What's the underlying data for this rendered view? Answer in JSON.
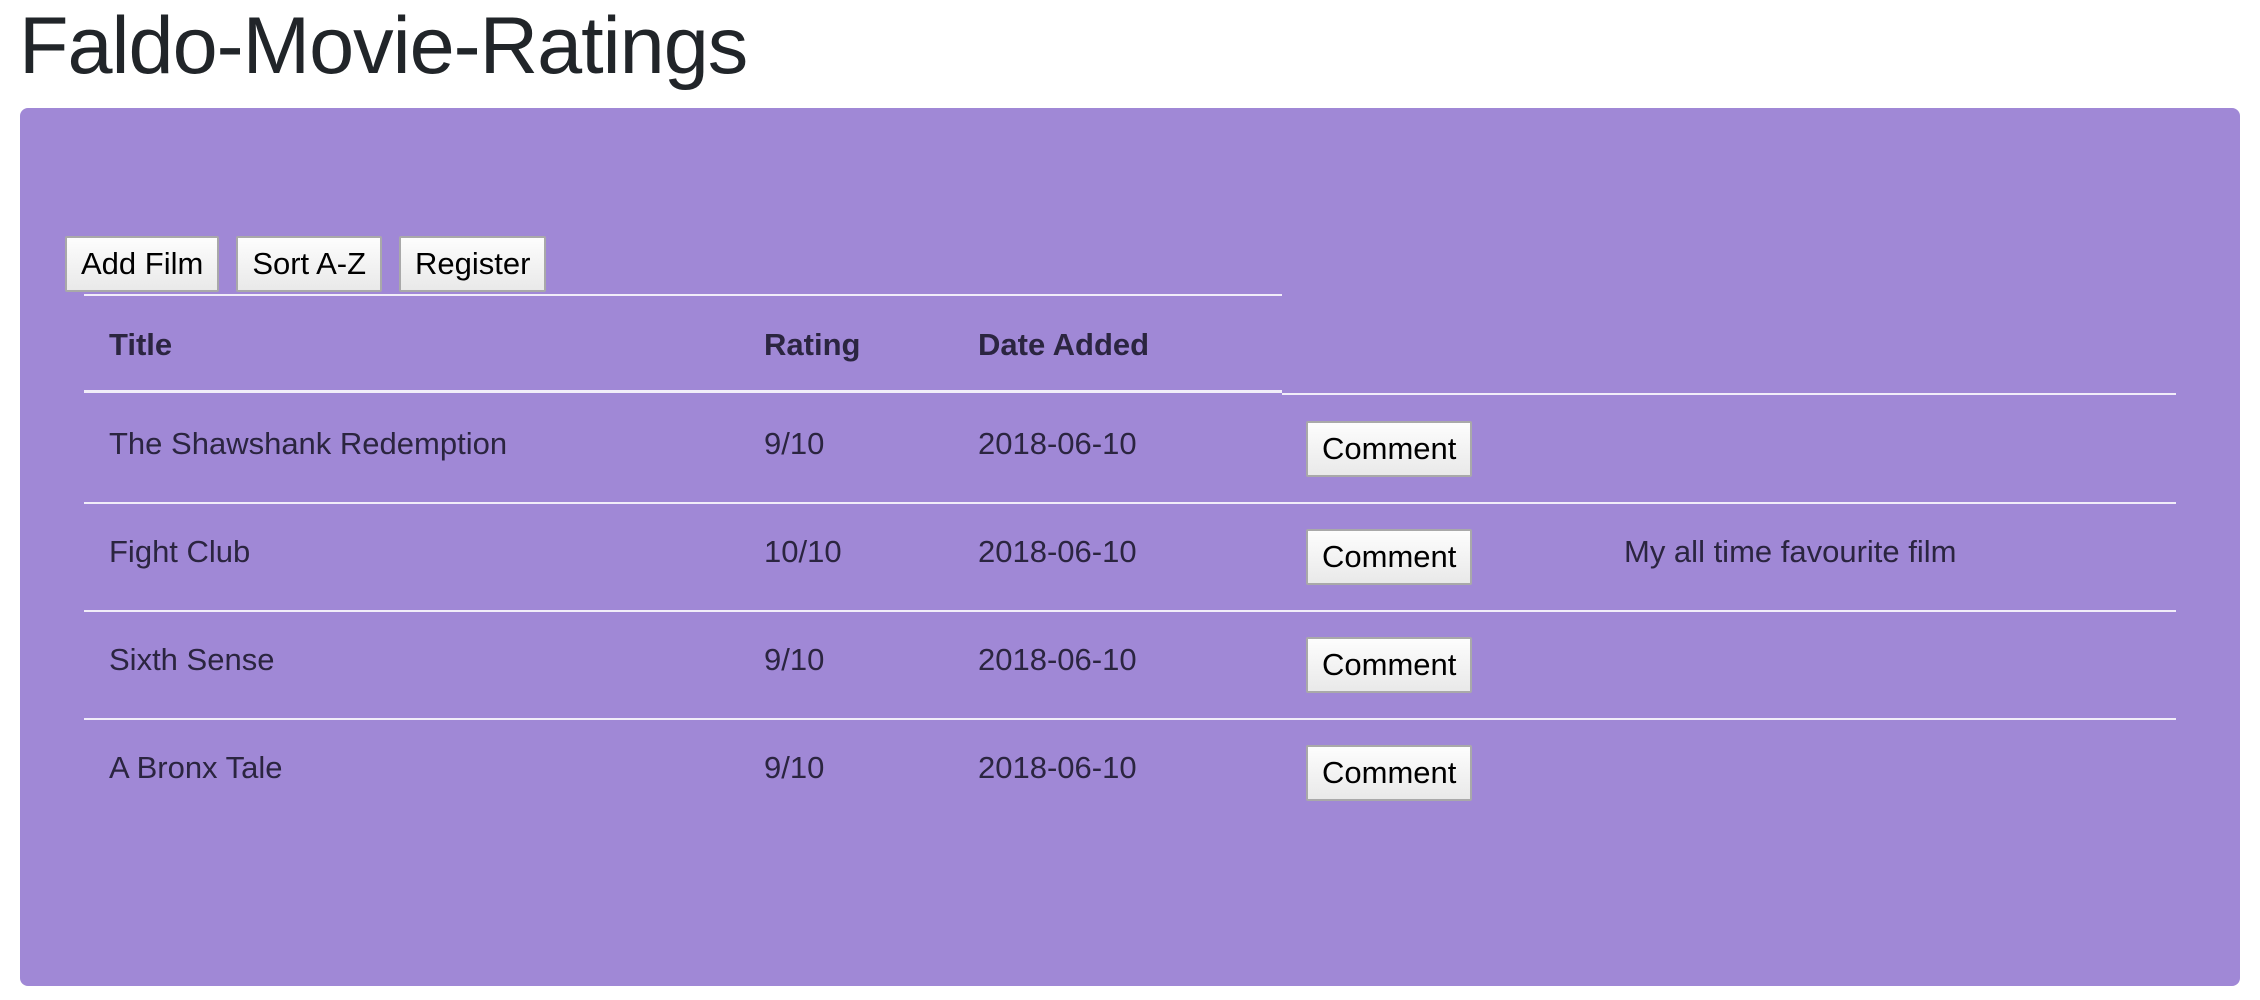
{
  "page": {
    "title": "Faldo-Movie-Ratings"
  },
  "toolbar": {
    "add_film_label": "Add Film",
    "sort_label": "Sort A-Z",
    "register_label": "Register"
  },
  "table": {
    "headers": {
      "title": "Title",
      "rating": "Rating",
      "date_added": "Date Added"
    },
    "comment_button_label": "Comment",
    "rows": [
      {
        "title": "The Shawshank Redemption",
        "rating": "9/10",
        "date_added": "2018-06-10",
        "comment": ""
      },
      {
        "title": "Fight Club",
        "rating": "10/10",
        "date_added": "2018-06-10",
        "comment": "My all time favourite film"
      },
      {
        "title": "Sixth Sense",
        "rating": "9/10",
        "date_added": "2018-06-10",
        "comment": ""
      },
      {
        "title": "A Bronx Tale",
        "rating": "9/10",
        "date_added": "2018-06-10",
        "comment": ""
      }
    ]
  },
  "colors": {
    "panel_background": "#a088d6",
    "text": "#212529"
  }
}
